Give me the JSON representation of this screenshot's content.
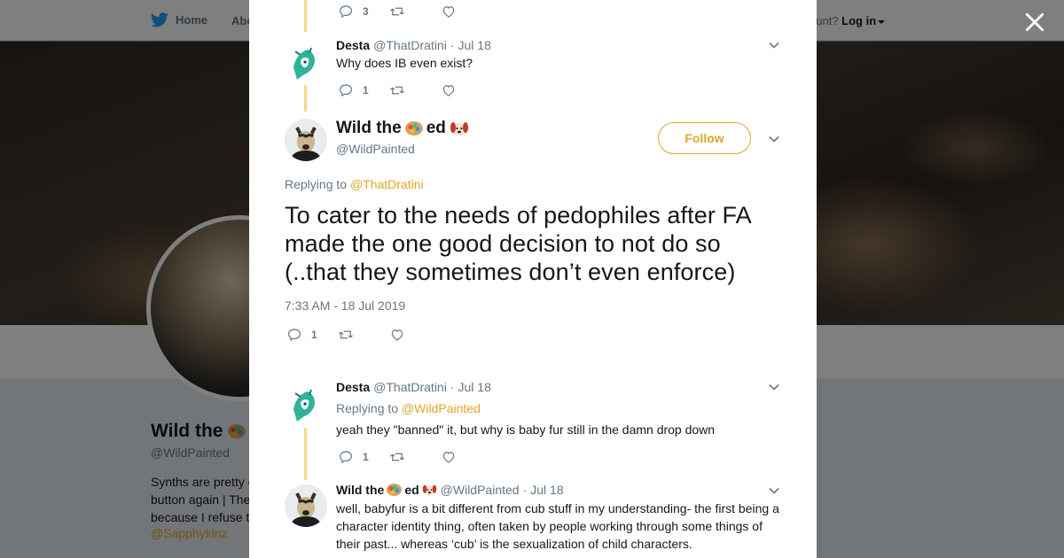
{
  "nav": {
    "home_label": "Home",
    "about_label": "Abe",
    "account_prompt": "ccount?",
    "login_label": "Log in"
  },
  "profile": {
    "name": "Wild the",
    "handle": "@WildPainted",
    "bio_lines": [
      "Synths are pretty c",
      "button again | The",
      "because I refuse t"
    ],
    "mention": "@Sapphykinz"
  },
  "top_actions": {
    "replies": "3"
  },
  "tweet1": {
    "name": "Desta",
    "handle": "@ThatDratini",
    "dot": "·",
    "date": "Jul 18",
    "text": "Why does IB even exist?",
    "replies": "1"
  },
  "main": {
    "name_a": "Wild the",
    "name_b": "ed",
    "handle": "@WildPainted",
    "follow_label": "Follow",
    "replying_prefix": "Replying to",
    "replying_to": "@ThatDratini",
    "text": "To cater to the needs of pedophiles after FA made the one good decision to not do so (..that they sometimes don’t even enforce)",
    "timestamp": "7:33 AM - 18 Jul 2019",
    "replies": "1"
  },
  "tweet2": {
    "name": "Desta",
    "handle": "@ThatDratini",
    "dot": "·",
    "date": "Jul 18",
    "replying_prefix": "Replying to",
    "replying_to": "@WildPainted",
    "text": "yeah they \"banned\" it, but why is baby fur still in the damn drop down",
    "replies": "1"
  },
  "tweet3": {
    "name_a": "Wild the",
    "name_b": "ed",
    "handle": "@WildPainted",
    "dot": "·",
    "date": "Jul 18",
    "text": "well, babyfur is a bit different from cub stuff in my understanding- the first being a character identity thing, often taken by people working through some things of their past... whereas ‘cub’ is the sexualization of child characters."
  },
  "colors": {
    "accent": "#e0a726",
    "thread_line": "#f5d98a",
    "muted": "#657786",
    "text": "#14171a"
  }
}
